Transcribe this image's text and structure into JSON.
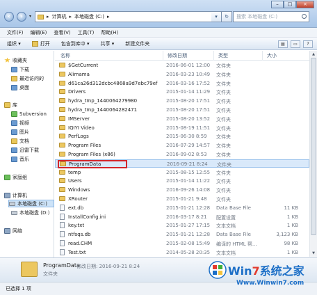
{
  "address": {
    "segments": [
      "计算机",
      "本地磁盘 (C:)"
    ],
    "search_placeholder": "搜索 本地磁盘 (C:)"
  },
  "menu": [
    "文件(F)",
    "编辑(E)",
    "查看(V)",
    "工具(T)",
    "帮助(H)"
  ],
  "toolbar": {
    "organize": "组织 ▾",
    "open": "打开",
    "include": "包含到库中 ▾",
    "share": "共享 ▾",
    "new_folder": "新建文件夹"
  },
  "nav": {
    "favorites": "收藏夹",
    "downloads": "下载",
    "recent": "最近访问的",
    "desktop": "桌面",
    "library": "库",
    "subversion": "Subversion",
    "videos": "视频",
    "pictures": "图片",
    "documents": "文档",
    "xunlei": "迅雷下载",
    "music": "音乐",
    "homegroup": "家庭组",
    "computer": "计算机",
    "drive_c": "本地磁盘 (C:)",
    "drive_d": "本地磁盘 (D:)",
    "network": "网络"
  },
  "columns": {
    "name": "名称",
    "date": "修改日期",
    "type": "类型",
    "size": "大小"
  },
  "files": [
    {
      "name": "$GetCurrent",
      "date": "2016-06-01 12:00",
      "type": "文件夹",
      "size": "",
      "kind": "folder"
    },
    {
      "name": "Alimama",
      "date": "2016-03-23 10:49",
      "type": "文件夹",
      "size": "",
      "kind": "folder"
    },
    {
      "name": "d61ca26d312dcbc4868a9d7ebc79ef",
      "date": "2016-03-16 17:52",
      "type": "文件夹",
      "size": "",
      "kind": "folder"
    },
    {
      "name": "Drivers",
      "date": "2015-01-14 11:29",
      "type": "文件夹",
      "size": "",
      "kind": "folder"
    },
    {
      "name": "hydra_tmp_1440064279980",
      "date": "2015-08-20 17:51",
      "type": "文件夹",
      "size": "",
      "kind": "folder"
    },
    {
      "name": "hydra_tmp_1440064282471",
      "date": "2015-08-20 17:51",
      "type": "文件夹",
      "size": "",
      "kind": "folder"
    },
    {
      "name": "IMServer",
      "date": "2015-08-20 13:52",
      "type": "文件夹",
      "size": "",
      "kind": "folder"
    },
    {
      "name": "IQIYI Video",
      "date": "2015-08-19 11:51",
      "type": "文件夹",
      "size": "",
      "kind": "folder"
    },
    {
      "name": "PerfLogs",
      "date": "2015-06-30 8:59",
      "type": "文件夹",
      "size": "",
      "kind": "folder"
    },
    {
      "name": "Program Files",
      "date": "2016-07-29 14:57",
      "type": "文件夹",
      "size": "",
      "kind": "folder"
    },
    {
      "name": "Program Files (x86)",
      "date": "2016-09-02 8:53",
      "type": "文件夹",
      "size": "",
      "kind": "folder"
    },
    {
      "name": "ProgramData",
      "date": "2016-09-21 8:24",
      "type": "文件夹",
      "size": "",
      "kind": "folder"
    },
    {
      "name": "temp",
      "date": "2015-08-15 12:55",
      "type": "文件夹",
      "size": "",
      "kind": "folder"
    },
    {
      "name": "Users",
      "date": "2015-01-14 11:22",
      "type": "文件夹",
      "size": "",
      "kind": "folder"
    },
    {
      "name": "Windows",
      "date": "2016-09-26 14:08",
      "type": "文件夹",
      "size": "",
      "kind": "folder"
    },
    {
      "name": "XRouter",
      "date": "2015-01-21 9:48",
      "type": "文件夹",
      "size": "",
      "kind": "folder"
    },
    {
      "name": "ext.db",
      "date": "2015-01-21 12:28",
      "type": "Data Base File",
      "size": "11 KB",
      "kind": "file"
    },
    {
      "name": "InstallConfig.ini",
      "date": "2016-03-17 8:21",
      "type": "配置设置",
      "size": "1 KB",
      "kind": "file"
    },
    {
      "name": "key.txt",
      "date": "2015-01-27 17:15",
      "type": "文本文档",
      "size": "1 KB",
      "kind": "file"
    },
    {
      "name": "ntfsqs.db",
      "date": "2015-01-21 12:28",
      "type": "Data Base File",
      "size": "3,123 KB",
      "kind": "file"
    },
    {
      "name": "read.CHM",
      "date": "2015-02-08 15:49",
      "type": "编译的 HTML 帮...",
      "size": "98 KB",
      "kind": "file"
    },
    {
      "name": "Test.txt",
      "date": "2014-05-28 20:35",
      "type": "文本文档",
      "size": "1 KB",
      "kind": "file"
    }
  ],
  "details": {
    "name": "ProgramData",
    "modified_label": "修改日期: 2016-09-21 8:24",
    "type": "文件夹"
  },
  "status": "已选择 1 项",
  "watermark": {
    "brand_w": "Win",
    "brand_7": "7",
    "brand_rest": "系统之家",
    "url": "Www.Winwin7.com"
  },
  "colors": {
    "selection": "#d9e9fa",
    "highlight_box": "#d3262c",
    "folder": "#ecc760"
  }
}
